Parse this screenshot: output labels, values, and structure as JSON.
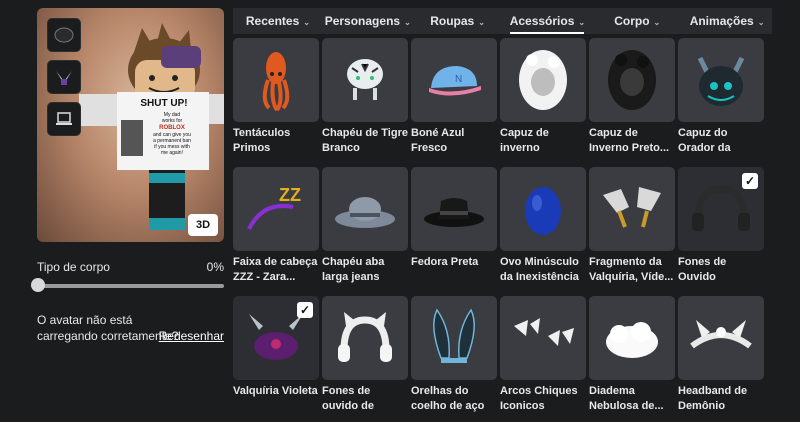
{
  "avatar": {
    "view_button": "3D",
    "shirt_text": [
      "SHUT UP!",
      "My dad",
      "works for",
      "ROBLOX",
      "and can give you",
      "a permanent ban",
      "if you mess with",
      "me again!"
    ]
  },
  "body_type": {
    "label": "Tipo de corpo",
    "value": "0%",
    "fraction": 0
  },
  "warning": {
    "text": "O avatar não está carregando corretamente?",
    "redraw_link": "Redesenhar"
  },
  "tabs": [
    {
      "label": "Recentes"
    },
    {
      "label": "Personagens"
    },
    {
      "label": "Roupas"
    },
    {
      "label": "Acessórios",
      "active": true
    },
    {
      "label": "Corpo"
    },
    {
      "label": "Animações"
    }
  ],
  "items": [
    {
      "name": "Tentáculos Primos",
      "icon": "squid-hat-icon",
      "selected": false
    },
    {
      "name": "Chapéu de Tigre Branco",
      "icon": "tiger-hat-icon",
      "selected": false
    },
    {
      "name": "Boné Azul Fresco",
      "icon": "blue-cap-icon",
      "selected": false
    },
    {
      "name": "Capuz de inverno branco...",
      "icon": "white-hood-icon",
      "selected": false
    },
    {
      "name": "Capuz de Inverno Preto...",
      "icon": "black-hood-icon",
      "selected": false
    },
    {
      "name": "Capuz do Orador da Morte...",
      "icon": "death-hood-icon",
      "selected": false
    },
    {
      "name": "Faixa de cabeça ZZZ - Zara...",
      "icon": "zzz-headband-icon",
      "selected": false
    },
    {
      "name": "Chapéu aba larga jeans Gucci",
      "icon": "denim-hat-icon",
      "selected": false
    },
    {
      "name": "Fedora Preta",
      "icon": "fedora-icon",
      "selected": false
    },
    {
      "name": "Ovo Minúsculo da Inexistência",
      "icon": "blue-egg-icon",
      "selected": false
    },
    {
      "name": "Fragmento da Valquíria, Víde...",
      "icon": "valkyrie-fragment-icon",
      "selected": false
    },
    {
      "name": "Fones de Ouvido Extremos",
      "icon": "headphones-icon",
      "selected": true
    },
    {
      "name": "Valquíria Violeta",
      "icon": "violet-valkyrie-icon",
      "selected": true
    },
    {
      "name": "Fones de ouvido de gatinho par...",
      "icon": "cat-headphones-icon",
      "selected": false
    },
    {
      "name": "Orelhas do coelho de aço",
      "icon": "bunny-ears-icon",
      "selected": false
    },
    {
      "name": "Arcos Chiques Iconicos Brancos",
      "icon": "white-bows-icon",
      "selected": false
    },
    {
      "name": "Diadema Nebulosa de...",
      "icon": "cloud-tiara-icon",
      "selected": false
    },
    {
      "name": "Headband de Demônio Cutes...",
      "icon": "demon-headband-icon",
      "selected": false
    }
  ],
  "colors": {
    "accent": "#ffffff",
    "tile": "#3b3c41",
    "background": "#1b1c1e"
  }
}
